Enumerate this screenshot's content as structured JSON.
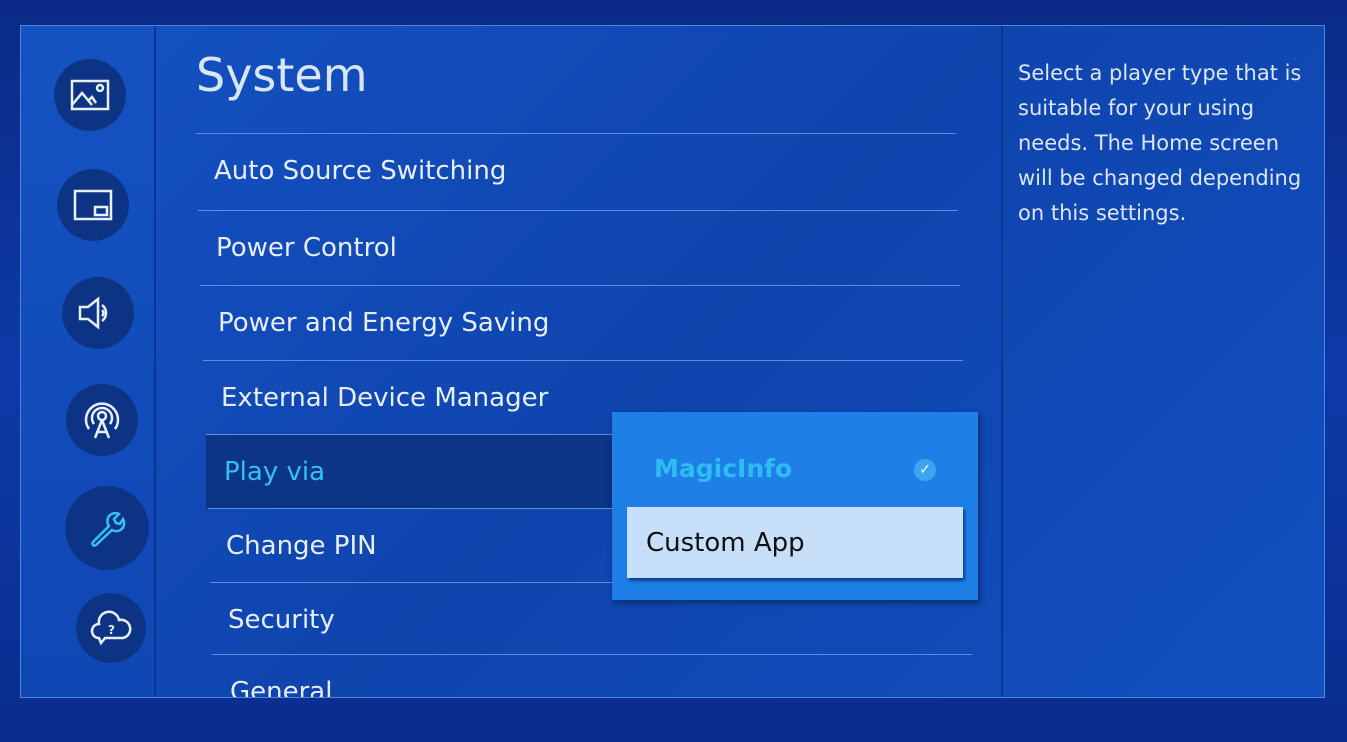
{
  "sidebar": {
    "items": [
      {
        "icon": "picture-icon",
        "label": "Picture"
      },
      {
        "icon": "pip-icon",
        "label": "PIP"
      },
      {
        "icon": "sound-icon",
        "label": "Sound"
      },
      {
        "icon": "network-icon",
        "label": "Network"
      },
      {
        "icon": "wrench-icon",
        "label": "System",
        "active": true
      },
      {
        "icon": "support-icon",
        "label": "Support"
      }
    ]
  },
  "main": {
    "title": "System",
    "items": [
      "Auto Source Switching",
      "Power Control",
      "Power and Energy Saving",
      "External Device Manager",
      "Play via",
      "Change PIN",
      "Security",
      "General"
    ],
    "selected_index": 4
  },
  "popup": {
    "options": [
      "MagicInfo",
      "Custom App"
    ],
    "checked": "MagicInfo",
    "focused": "Custom App"
  },
  "help": {
    "text": "Select a player type that is suitable for your using needs. The Home screen will be changed depending on this settings."
  },
  "colors": {
    "accent": "#35c0f4",
    "popup": "#1e80e6",
    "focus": "#c7dff8"
  }
}
